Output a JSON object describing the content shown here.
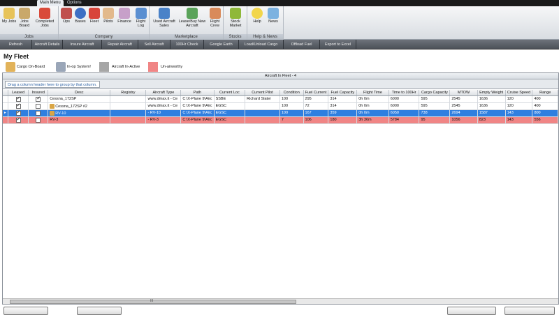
{
  "ribbon": {
    "tabs": [
      {
        "label": "Main Menu"
      },
      {
        "label": "Options"
      }
    ],
    "groups": [
      {
        "label": "Jobs",
        "buttons": [
          {
            "label": "My Jobs"
          },
          {
            "label": "Jobs Board"
          },
          {
            "label": "Completed Jobs"
          }
        ]
      },
      {
        "label": "Company",
        "buttons": [
          {
            "label": "Ops"
          },
          {
            "label": "Bases"
          },
          {
            "label": "Fleet"
          },
          {
            "label": "Pilots"
          },
          {
            "label": "Finance"
          },
          {
            "label": "Flight Log"
          }
        ]
      },
      {
        "label": "Marketplace",
        "buttons": [
          {
            "label": "Used Aircraft Sales"
          },
          {
            "label": "Lease/Buy New Aircraft"
          },
          {
            "label": "Flight Crew"
          }
        ]
      },
      {
        "label": "Stocks",
        "buttons": [
          {
            "label": "Stock Market"
          }
        ]
      },
      {
        "label": "Help & News",
        "buttons": [
          {
            "label": "Help"
          },
          {
            "label": "News"
          }
        ]
      }
    ]
  },
  "toolbar": {
    "buttons": [
      {
        "label": "Refresh"
      },
      {
        "label": "Aircraft Details"
      },
      {
        "label": "Insure Aircraft"
      },
      {
        "label": "Repair Aircraft"
      },
      {
        "label": "Sell Aircraft"
      },
      {
        "label": "100Hr Check"
      },
      {
        "label": "Google Earth"
      },
      {
        "label": "Load/Unload Cargo"
      },
      {
        "label": "Offload Fuel"
      },
      {
        "label": "Export to Excel"
      }
    ]
  },
  "page": {
    "title": "My Fleet"
  },
  "legend": {
    "cargo": "Cargo On-Board",
    "inop": "In-op System!",
    "inactive": "Aircraft In-Active",
    "unairworthy": "Un-airworthy",
    "colors": {
      "inactive": "#a6a6a6",
      "unairworthy": "#f08585",
      "selected": "#2f7fe0"
    }
  },
  "grid": {
    "caption": "Aircraft In Fleet - 4",
    "group_hint": "Drag a column header here to group by that column.",
    "columns": [
      "Leased",
      "Insured",
      "Desc",
      "Registry",
      "Aircraft Type",
      "Path",
      "Current Loc",
      "Current Pilot",
      "Condition",
      "Fuel Current",
      "Fuel Capacity",
      "Flight Time",
      "Time to 100Hr",
      "Cargo Capacity",
      "MTOW",
      "Empty Weight",
      "Cruise Speed",
      "Range"
    ],
    "rows": [
      {
        "leased": true,
        "insured": true,
        "cargo": false,
        "cells": [
          "Cessna_172SP",
          "",
          "www.dmax.it - Ce",
          "C:\\X-Plane 9\\Airc",
          "SSBE",
          "Richard Slater",
          "100",
          "295",
          "314",
          "0h 0m",
          "6000",
          "595",
          "2545",
          "1636",
          "120",
          "400"
        ]
      },
      {
        "leased": true,
        "insured": false,
        "cargo": true,
        "cells": [
          "Cessna_172SP #2",
          "",
          "www.dmax.it - Ce",
          "C:\\X-Plane 9\\Airc",
          "EGSC",
          "",
          "100",
          "72",
          "314",
          "0h 0m",
          "6000",
          "595",
          "2545",
          "1636",
          "120",
          "400"
        ]
      },
      {
        "leased": true,
        "insured": false,
        "cargo": true,
        "cells": [
          "RV-10",
          "",
          "- RV-10",
          "C:\\X-Plane 9\\Airc",
          "EGSC",
          "",
          "100",
          "167",
          "359",
          "0h 0m",
          "6050",
          "738",
          "2694",
          "1587",
          "143",
          "800"
        ]
      },
      {
        "leased": true,
        "insured": false,
        "cargo": false,
        "cells": [
          "RV-3",
          "",
          "- RV-3",
          "C:\\X-Plane 9\\Airc",
          "EGSC",
          "",
          "7",
          "106",
          "180",
          "3h 36m",
          "5784",
          "95",
          "1056",
          "823",
          "143",
          "556"
        ]
      }
    ]
  },
  "scroll": {
    "grip": "III"
  }
}
